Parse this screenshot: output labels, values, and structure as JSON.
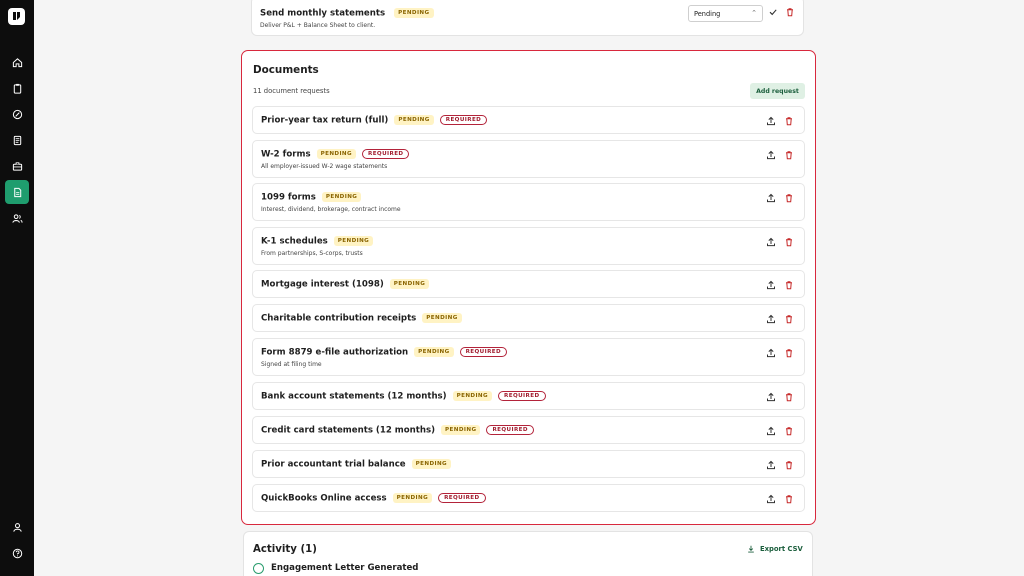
{
  "task": {
    "title": "Send monthly statements",
    "status": "PENDING",
    "description": "Deliver P&L + Balance Sheet to client.",
    "select_value": "Pending"
  },
  "documents": {
    "title": "Documents",
    "count_text": "11 document requests",
    "add_label": "Add request",
    "items": [
      {
        "name": "Prior-year tax return (full)",
        "status": "PENDING",
        "required": "REQUIRED",
        "desc": ""
      },
      {
        "name": "W-2 forms",
        "status": "PENDING",
        "required": "REQUIRED",
        "desc": "All employer-issued W-2 wage statements"
      },
      {
        "name": "1099 forms",
        "status": "PENDING",
        "required": "",
        "desc": "Interest, dividend, brokerage, contract income"
      },
      {
        "name": "K-1 schedules",
        "status": "PENDING",
        "required": "",
        "desc": "From partnerships, S-corps, trusts"
      },
      {
        "name": "Mortgage interest (1098)",
        "status": "PENDING",
        "required": "",
        "desc": ""
      },
      {
        "name": "Charitable contribution receipts",
        "status": "PENDING",
        "required": "",
        "desc": ""
      },
      {
        "name": "Form 8879 e-file authorization",
        "status": "PENDING",
        "required": "REQUIRED",
        "desc": "Signed at filing time"
      },
      {
        "name": "Bank account statements (12 months)",
        "status": "PENDING",
        "required": "REQUIRED",
        "desc": ""
      },
      {
        "name": "Credit card statements (12 months)",
        "status": "PENDING",
        "required": "REQUIRED",
        "desc": ""
      },
      {
        "name": "Prior accountant trial balance",
        "status": "PENDING",
        "required": "",
        "desc": ""
      },
      {
        "name": "QuickBooks Online access",
        "status": "PENDING",
        "required": "REQUIRED",
        "desc": ""
      }
    ]
  },
  "activity": {
    "title": "Activity (1)",
    "export_label": "Export CSV",
    "first_item": "Engagement Letter Generated"
  },
  "colors": {
    "accent": "#1f9d6e",
    "danger": "#d8283d",
    "pending_bg": "#fff3c4"
  },
  "icons": [
    "home-icon",
    "clipboard-icon",
    "gauge-icon",
    "receipt-icon",
    "briefcase-icon",
    "document-icon",
    "users-icon",
    "user-icon",
    "help-icon",
    "upload-icon",
    "trash-icon",
    "check-icon",
    "download-icon"
  ]
}
